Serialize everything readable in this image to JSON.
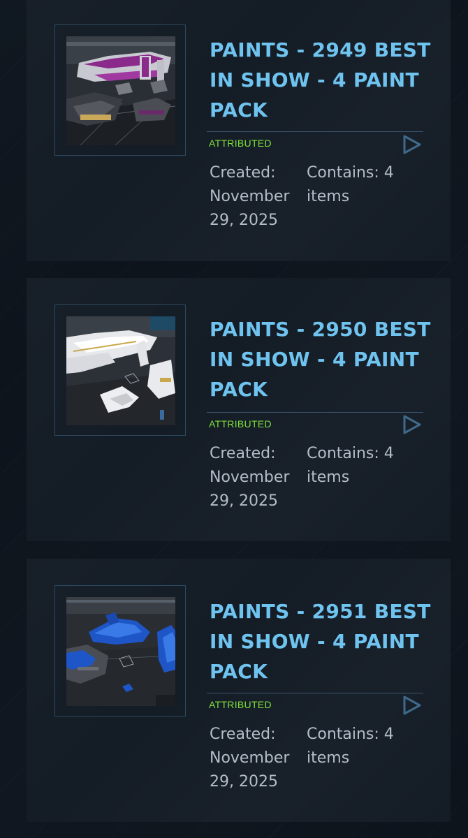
{
  "items": [
    {
      "title": "PAINTS - 2949 BEST IN SHOW - 4 PAINT PACK",
      "status": "ATTRIBUTED",
      "created": "Created: November 29, 2025",
      "contains": "Contains: 4 items",
      "thumbnail_icon": "ship-paint-thumbnail-purple"
    },
    {
      "title": "PAINTS - 2950 BEST IN SHOW - 4 PAINT PACK",
      "status": "ATTRIBUTED",
      "created": "Created: November 29, 2025",
      "contains": "Contains: 4 items",
      "thumbnail_icon": "ship-paint-thumbnail-white"
    },
    {
      "title": "PAINTS - 2951 BEST IN SHOW - 4 PAINT PACK",
      "status": "ATTRIBUTED",
      "created": "Created: November 29, 2025",
      "contains": "Contains: 4 items",
      "thumbnail_icon": "ship-paint-thumbnail-blue"
    }
  ],
  "colors": {
    "title": "#6fc3ef",
    "status": "#7ee03a",
    "meta": "#b4bec8",
    "card_bg": "#141c26",
    "page_bg": "#0e141c"
  }
}
